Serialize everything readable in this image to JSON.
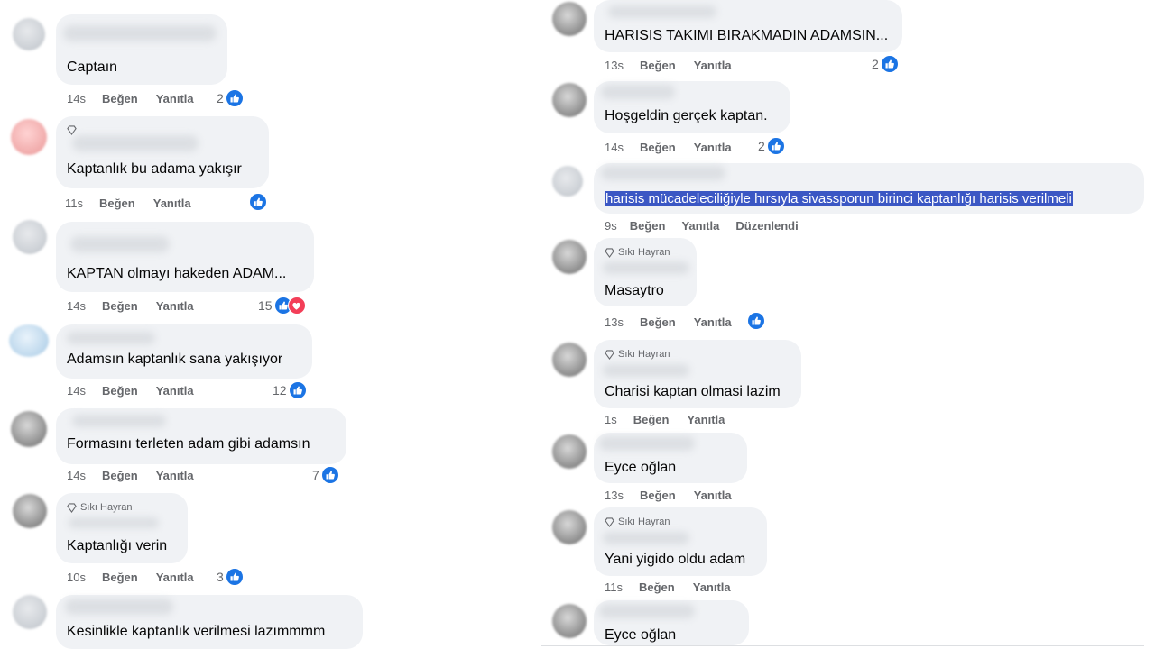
{
  "colors": {
    "bubble": "#f0f2f5",
    "like": "#1b74e4",
    "love": "#f33e58",
    "selection": "#3b57c4",
    "meta": "#65676b"
  },
  "labels": {
    "like": "Beğen",
    "reply": "Yanıtla",
    "edited": "Düzenlendi",
    "top_fan": "Sıkı Hayran"
  },
  "left_comments": [
    {
      "text": "Captaın",
      "time": "14s",
      "likes": "2"
    },
    {
      "text": "Kaptanlık bu adama yakışır",
      "time": "11s",
      "likes": ""
    },
    {
      "text": "KAPTAN olmayı hakeden ADAM...",
      "time": "14s",
      "likes": "15"
    },
    {
      "text": "Adamsın kaptanlık sana yakışıyor",
      "time": "14s",
      "likes": "12"
    },
    {
      "text": "Formasını terleten adam gibi adamsın",
      "time": "14s",
      "likes": "7"
    },
    {
      "text": "Kaptanlığı verin",
      "time": "10s",
      "likes": "3"
    },
    {
      "text": "Kesinlikle kaptanlık verilmesi lazımmmm",
      "time": "",
      "likes": ""
    }
  ],
  "right_comments": [
    {
      "text": "HARISIS TAKIMI BIRAKMADIN ADAMSIN...",
      "time": "13s",
      "likes": "2"
    },
    {
      "text": "Hoşgeldin gerçek kaptan.",
      "time": "14s",
      "likes": "2"
    },
    {
      "text": "harisis mücadeleciliğiyle hırsıyla sivassporun birinci kaptanlığı harisis verilmeli",
      "time": "9s",
      "likes": ""
    },
    {
      "text": "Masaytro",
      "time": "13s",
      "likes": ""
    },
    {
      "text": "Charisi kaptan olmasi lazim",
      "time": "1s",
      "likes": ""
    },
    {
      "text": "Eyce oğlan",
      "time": "13s",
      "likes": ""
    },
    {
      "text": "Yani yigido oldu adam",
      "time": "11s",
      "likes": ""
    },
    {
      "text": "Eyce oğlan",
      "time": "",
      "likes": ""
    }
  ]
}
